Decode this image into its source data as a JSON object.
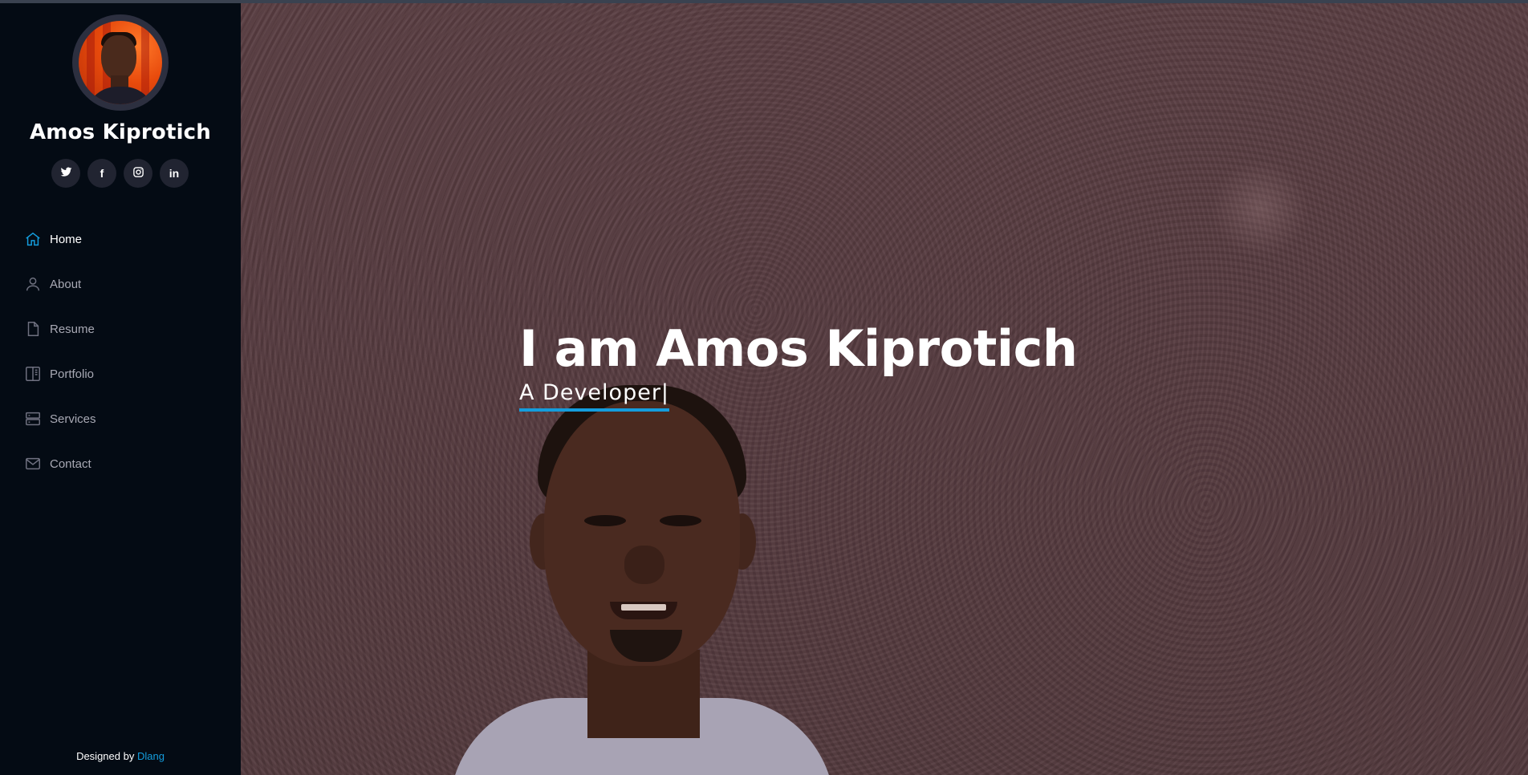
{
  "profile": {
    "name": "Amos Kiprotich",
    "avatar_alt": "profile-photo"
  },
  "social": [
    {
      "name": "twitter",
      "icon": "twitter-icon"
    },
    {
      "name": "facebook",
      "icon": "facebook-icon",
      "glyph": "f"
    },
    {
      "name": "instagram",
      "icon": "instagram-icon"
    },
    {
      "name": "linkedin",
      "icon": "linkedin-icon",
      "glyph": "in"
    }
  ],
  "nav": {
    "items": [
      {
        "label": "Home",
        "icon": "home-icon",
        "active": true
      },
      {
        "label": "About",
        "icon": "person-icon"
      },
      {
        "label": "Resume",
        "icon": "file-icon"
      },
      {
        "label": "Portfolio",
        "icon": "book-icon"
      },
      {
        "label": "Services",
        "icon": "server-icon"
      },
      {
        "label": "Contact",
        "icon": "envelope-icon"
      }
    ]
  },
  "footer": {
    "prefix": "Designed by",
    "author": "Dlang"
  },
  "hero": {
    "title": "I am Amos Kiprotich",
    "subtitle": "A Developer|"
  },
  "colors": {
    "accent": "#149ddd",
    "sidebar_bg": "#040b14"
  }
}
